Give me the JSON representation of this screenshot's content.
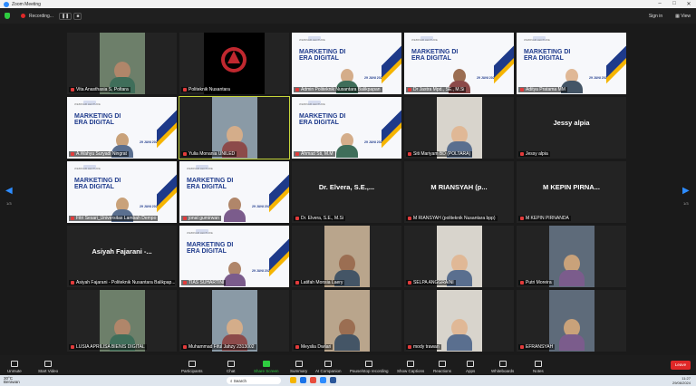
{
  "window": {
    "title": "Zoom Meeting"
  },
  "topbar": {
    "recording_label": "Recording...",
    "sign_in": "Sign in",
    "view": "View"
  },
  "pager": {
    "left": "1/3",
    "right": "1/3"
  },
  "slide": {
    "mini": "WEBINAR LECTURE",
    "title": "MARKETING DI ERA DIGITAL",
    "date": "29 JUNI 2024"
  },
  "participants": [
    {
      "name": "Vita Anasthasia S, Poltara",
      "type": "cam"
    },
    {
      "name": "Politeknik Nusantara",
      "type": "logo"
    },
    {
      "name": "Admin Politeknik Nusantara Balikpapan",
      "type": "slide"
    },
    {
      "name": "Dr Jastra Mpd., SE., M.Si",
      "type": "slide"
    },
    {
      "name": "Aditya Pratama MM",
      "type": "slide"
    },
    {
      "name": "A.Wahyu Suryadi Ningrat",
      "type": "slide"
    },
    {
      "name": "Yulia Monania UNILED",
      "type": "cam",
      "active": true
    },
    {
      "name": "Ahmad Sti, M.M",
      "type": "slide"
    },
    {
      "name": "Siti Mariyam BD (POLTARA)",
      "type": "cam"
    },
    {
      "name": "Jessy alpia",
      "type": "text",
      "big": "Jessy alpia"
    },
    {
      "name": "Fitri Sesari_Universitas Lambah Dempo",
      "type": "slide"
    },
    {
      "name": "jonat gumirwan",
      "type": "slide"
    },
    {
      "name": "Dr. Elvera, S.E., M.Si",
      "type": "text",
      "big": "Dr. Elvera, S.E.,..."
    },
    {
      "name": "M RIANSYAH (politeknik Nusantara bpp)",
      "type": "text",
      "big": "M RIANSYAH (p..."
    },
    {
      "name": "M KEPIN PIRNANDA",
      "type": "text",
      "big": "M KEPIN PIRNA..."
    },
    {
      "name": "Asiyah Fajarani - Politeknik Nusantara Balikpap...",
      "type": "text",
      "big": "Asiyah Fajarani -..."
    },
    {
      "name": "TIAS SUHARTINI",
      "type": "slide"
    },
    {
      "name": "Latifah Monsia Laery",
      "type": "cam"
    },
    {
      "name": "SELPA ANGGRAINI",
      "type": "cam"
    },
    {
      "name": "Putri Moreira",
      "type": "cam"
    },
    {
      "name": "LUSIA APRILISA BIENIS DIGITAL",
      "type": "cam"
    },
    {
      "name": "Muhammad Fiful Jahzy 2313002",
      "type": "cam"
    },
    {
      "name": "Meyslia Dwilari",
      "type": "cam"
    },
    {
      "name": "mody trawan",
      "type": "cam"
    },
    {
      "name": "EFRANSYAH",
      "type": "cam"
    }
  ],
  "toolbar": {
    "unmute": "Unmute",
    "start_video": "Start Video",
    "participants": "Participants",
    "participants_count": "64",
    "chat": "Chat",
    "share": "Share Screen",
    "summary": "Summary",
    "ai": "AI Companion",
    "record": "Pause/stop recording",
    "captions": "Show Captions",
    "reactions": "Reactions",
    "apps": "Apps",
    "whiteboards": "Whiteboards",
    "notes": "Notes",
    "leave": "Leave"
  },
  "taskbar": {
    "temp": "30°C",
    "weather": "Berawan",
    "search": "Search",
    "time": "11:27",
    "date": "29/06/2024"
  },
  "colors": {
    "accent": "#2d8cff",
    "danger": "#e02828",
    "share": "#2ecc40"
  }
}
